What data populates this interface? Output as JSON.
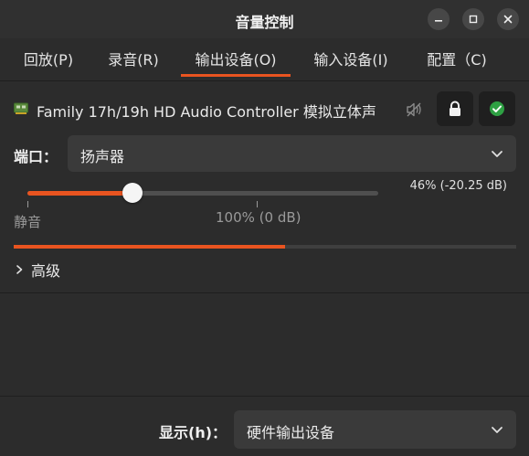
{
  "window": {
    "title": "音量控制"
  },
  "tabs": [
    {
      "label": "回放(P)",
      "active": false
    },
    {
      "label": "录音(R)",
      "active": false
    },
    {
      "label": "输出设备(O)",
      "active": true
    },
    {
      "label": "输入设备(I)",
      "active": false
    },
    {
      "label": "配置（C)",
      "active": false
    }
  ],
  "device": {
    "name": "Family 17h/19h HD Audio Controller 模拟立体声",
    "icons": {
      "card": "sound-card-icon",
      "mute": "speaker-muted-icon",
      "lock": "lock-icon",
      "default": "check-circle-icon"
    }
  },
  "port": {
    "label": "端口：",
    "selected": "扬声器"
  },
  "volume": {
    "percent_text": "46% (-20.25 dB)",
    "value_percent": 46,
    "mute_mark": "静音",
    "hundred_mark": "100% (0 dB)"
  },
  "level_meter": {
    "fill_fraction": 0.54
  },
  "advanced": {
    "label": "高级"
  },
  "show": {
    "label": "显示(h)：",
    "selected": "硬件输出设备"
  },
  "colors": {
    "accent": "#e95420",
    "background": "#2c2c2c",
    "default_check": "#2ea043"
  }
}
